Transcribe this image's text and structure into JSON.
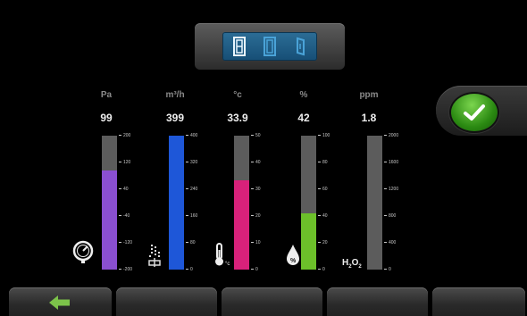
{
  "mode_selector": {
    "segments": [
      {
        "icon": "door-closed-icon",
        "active": true
      },
      {
        "icon": "door-open-icon",
        "active": false
      },
      {
        "icon": "door-ajar-icon",
        "active": false
      }
    ],
    "color_active": "#e8f6ff",
    "color_inactive": "#4aa3d8"
  },
  "gauges": [
    {
      "id": "pressure",
      "unit": "Pa",
      "value": "99",
      "icon": "pressure-gauge-icon",
      "fill_fraction": 0.74,
      "fill_color": "#8a4fd0",
      "track_color": "#5c5c5c",
      "ticks": [
        "200",
        "120",
        "40",
        "-40",
        "-120",
        "-200"
      ]
    },
    {
      "id": "airflow",
      "unit": "m³/h",
      "value": "399",
      "icon": "airflow-fan-icon",
      "fill_fraction": 1.0,
      "fill_color": "#1e57d8",
      "track_color": "#5c5c5c",
      "ticks": [
        "400",
        "320",
        "240",
        "160",
        "80",
        "0"
      ]
    },
    {
      "id": "temperature",
      "unit": "°c",
      "value": "33.9",
      "icon": "thermometer-icon",
      "fill_fraction": 0.67,
      "fill_color": "#d8217a",
      "track_color": "#5c5c5c",
      "ticks": [
        "50",
        "40",
        "30",
        "20",
        "10",
        "0"
      ]
    },
    {
      "id": "humidity",
      "unit": "%",
      "value": "42",
      "icon": "humidity-drop-icon",
      "fill_fraction": 0.42,
      "fill_color": "#6cc02a",
      "track_color": "#5c5c5c",
      "ticks": [
        "100",
        "80",
        "60",
        "40",
        "20",
        "0"
      ]
    },
    {
      "id": "h2o2",
      "unit": "ppm",
      "value": "1.8",
      "icon": "h2o2-label",
      "icon_text": {
        "main": "H",
        "sub1": "2",
        "mid": "O",
        "sub2": "2"
      },
      "fill_fraction": 0.0,
      "fill_color": "#b7c63a",
      "track_color": "#5c5c5c",
      "ticks": [
        "2000",
        "1600",
        "1200",
        "800",
        "400",
        "0"
      ]
    }
  ],
  "confirm": {
    "icon": "checkmark-icon"
  },
  "toolbar": {
    "buttons": [
      {
        "icon": "back-arrow-icon"
      },
      {
        "icon": ""
      },
      {
        "icon": ""
      },
      {
        "icon": ""
      },
      {
        "icon": ""
      }
    ],
    "accent": "#7cc24a"
  }
}
